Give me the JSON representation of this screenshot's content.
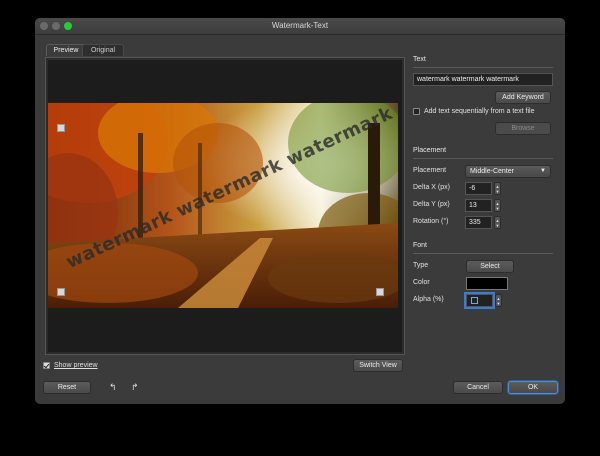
{
  "window": {
    "title": "Watermark-Text"
  },
  "tabs": [
    {
      "label": "Preview"
    },
    {
      "label": "Original"
    }
  ],
  "preview": {
    "watermark_overlay": "watermark watermark watermark"
  },
  "text_section": {
    "title": "Text",
    "value": "watermark watermark watermark",
    "add_keyword_label": "Add Keyword",
    "sequential_label": "Add text sequentially from a text file",
    "sequential_checked": false,
    "browse_label": "Browse"
  },
  "placement_section": {
    "title": "Placement",
    "placement_label": "Placement",
    "placement_value": "Middle-Center",
    "delta_x_label": "Delta X (px)",
    "delta_x_value": "-6",
    "delta_y_label": "Delta Y (px)",
    "delta_y_value": "13",
    "rotation_label": "Rotation (°)",
    "rotation_value": "335"
  },
  "font_section": {
    "title": "Font",
    "type_label": "Type",
    "select_label": "Select",
    "color_label": "Color",
    "color_value": "#000000",
    "alpha_label": "Alpha (%)"
  },
  "footer": {
    "show_preview_label": "Show preview",
    "show_preview_checked": true,
    "switch_view_label": "Switch View",
    "reset_label": "Reset",
    "undo_icon": "undo-arrow-icon",
    "redo_icon": "redo-arrow-icon",
    "cancel_label": "Cancel",
    "ok_label": "OK"
  },
  "colors": {
    "accent": "#3a7bd5",
    "window_bg": "#3b3b3b",
    "maximize": "#28c840"
  }
}
